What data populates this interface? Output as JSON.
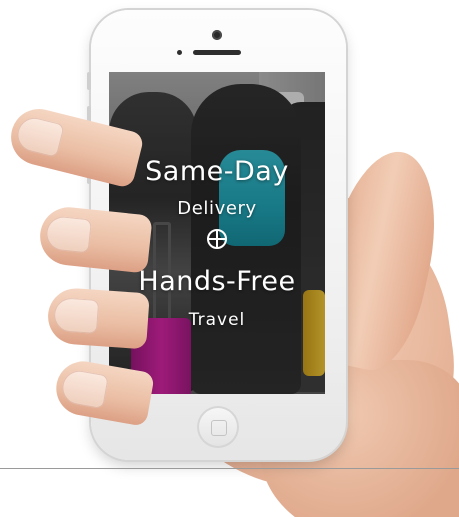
{
  "screen": {
    "headline_1": "Same-Day",
    "subline_1": "Delivery",
    "emblem_icon": "circle-cross-icon",
    "headline_2": "Hands-Free",
    "subline_2": "Travel"
  },
  "colors": {
    "text": "#ffffff",
    "backpack": "#1aa0b2",
    "suitcase": "#c41a93",
    "phone_body": "#f3f3f3"
  }
}
